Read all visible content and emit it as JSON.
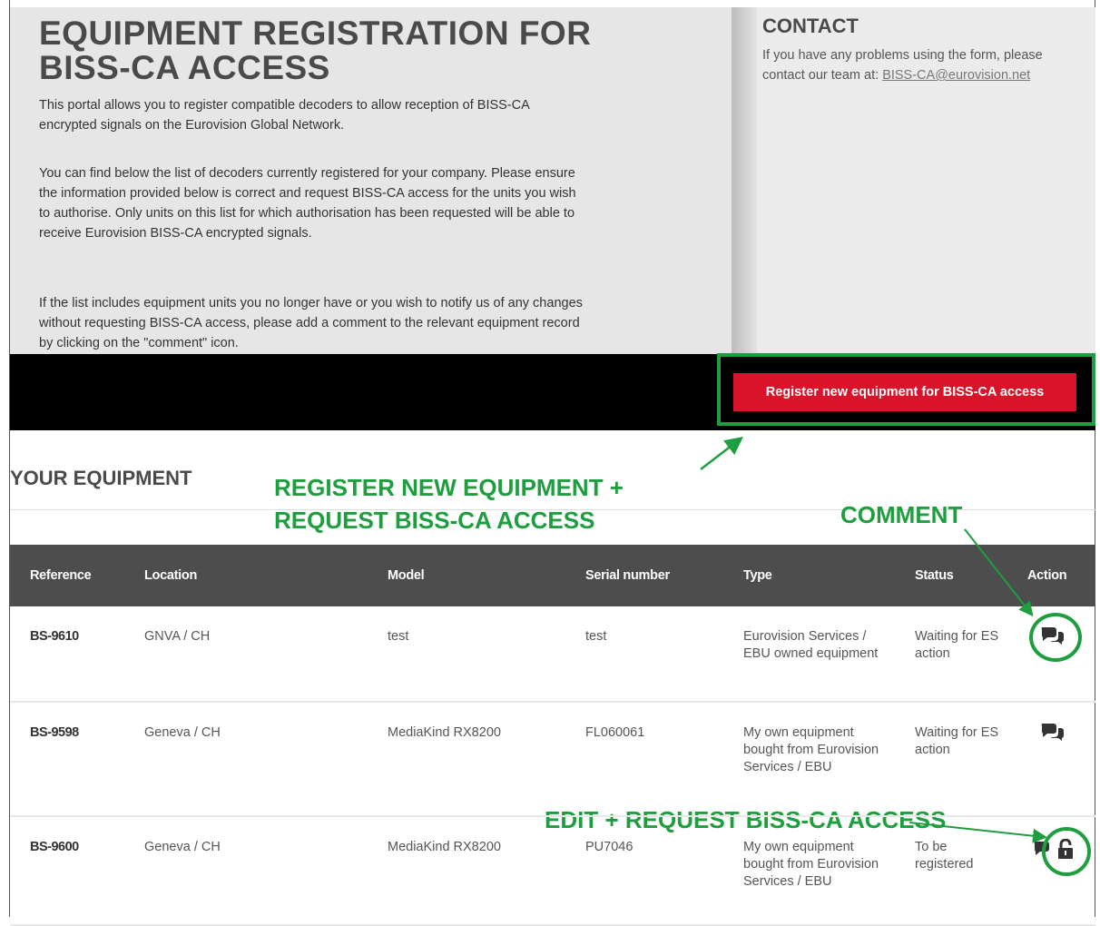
{
  "intro": {
    "title": "EQUIPMENT REGISTRATION FOR BISS-CA ACCESS",
    "paragraph1": "This portal allows you to register compatible decoders to allow reception of BISS-CA encrypted signals on the Eurovision Global Network.",
    "paragraph2": "You can find below the list of decoders currently registered for your company. Please ensure the information provided below is correct and request BISS-CA access for the units you wish to authorise. Only units on this list for which authorisation has been requested will be able to receive Eurovision BISS-CA encrypted signals.",
    "paragraph3": "If the list includes equipment units you no longer have or you wish to notify us of any changes without requesting BISS-CA access, please add a comment to the relevant equipment record by clicking on the \"comment\" icon."
  },
  "contact": {
    "title": "CONTACT",
    "text": "If you have any problems using the form, please contact our team at: ",
    "email": "BISS-CA@eurovision.net"
  },
  "register_button": "Register new equipment for BISS-CA access",
  "equipment": {
    "title": "YOUR EQUIPMENT",
    "columns": [
      "Reference",
      "Location",
      "Model",
      "Serial number",
      "Type",
      "Status",
      "Action"
    ],
    "rows": [
      {
        "reference": "BS-9610",
        "location": "GNVA / CH",
        "model": "test",
        "serial": "test",
        "type": "Eurovision Services / EBU owned equipment",
        "status": "Waiting for ES action",
        "actions": [
          "comment-icon"
        ]
      },
      {
        "reference": "BS-9598",
        "location": "Geneva / CH",
        "model": "MediaKind RX8200",
        "serial": "FL060061",
        "type": "My own equipment bought from Eurovision Services / EBU",
        "status": "Waiting for ES action",
        "actions": [
          "comment-icon"
        ]
      },
      {
        "reference": "BS-9600",
        "location": "Geneva / CH",
        "model": "MediaKind RX8200",
        "serial": "PU7046",
        "type": "My own equipment bought from Eurovision Services / EBU",
        "status": "To be registered",
        "actions": [
          "comment-icon",
          "unlock-icon"
        ]
      }
    ]
  },
  "annotations": {
    "register": "REGISTER NEW EQUIPMENT + REQUEST BISS-CA ACCESS",
    "comment": "COMMENT",
    "edit": "EDIT + REQUEST BISS-CA ACCESS",
    "color": "#1e9e3e"
  },
  "colors": {
    "button": "#d9142a",
    "table_header": "#4d4d4d"
  }
}
